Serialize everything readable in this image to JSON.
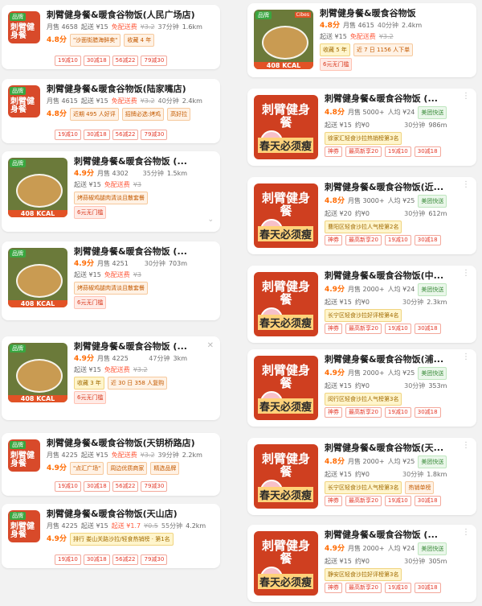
{
  "shop_name": "刺臂健身餐&暖食谷物饭",
  "left": [
    {
      "name": "刺臂健身餐&暖食谷物饭(人民广场店)",
      "sales": "月售 4658",
      "start": "起送 ¥15",
      "free": "免配送费",
      "orig": "¥3.2",
      "eta": "37分钟",
      "dist": "1.6km",
      "score": "4.8分",
      "badges": [
        "\"沙面街腊海鲜卖\"",
        "收藏 4 年"
      ],
      "coupons": [
        "19减10",
        "30减18",
        "56减22",
        "79减30"
      ]
    },
    {
      "name": "刺臂健身餐&暖食谷物饭(陆家嘴店)",
      "sales": "月售 4615",
      "start": "起送 ¥15",
      "free": "免配送费",
      "orig": "¥3.2",
      "eta": "40分钟",
      "dist": "2.4km",
      "score": "4.8分",
      "badges": [
        "近期 495 人好评",
        "招牌必选:烤鸡",
        "高好拉"
      ],
      "coupons": [
        "19减10",
        "30减18",
        "56减22",
        "79减30"
      ]
    },
    {
      "name": "刺臂健身餐&暖食谷物饭 (...",
      "score": "4.9分",
      "sales": "月售 4302",
      "eta": "35分钟",
      "dist": "1.5km",
      "start": "起送 ¥15",
      "free": "免配送费",
      "orig": "¥3",
      "badges": [
        "烤蒜椒鸡腿肉清淡且散套餐",
        "6元无门槛"
      ],
      "coupons": [
        "19减10",
        "30减18",
        "56减22",
        "79减30"
      ],
      "kcal": "408 KCAL",
      "tag": "品牌"
    },
    {
      "name": "刺臂健身餐&暖食谷物饭 (...",
      "score": "4.9分",
      "sales": "月售 4251",
      "eta": "30分钟",
      "dist": "703m",
      "start": "起送 ¥15",
      "free": "免配送费",
      "orig": "¥3",
      "badges": [
        "烤蒜椒鸡腿肉清淡且散套餐",
        "6元无门槛"
      ],
      "coupons": [],
      "kcal": "408 KCAL",
      "tag": "品牌"
    },
    {
      "name": "刺臂健身餐&暖食谷物饭 (...",
      "score": "4.9分",
      "sales": "月售 4225",
      "eta": "47分钟",
      "dist": "3km",
      "start": "起送 ¥15",
      "free": "免配送费",
      "orig": "¥3.2",
      "badges": [
        "收藏 3 年",
        "近 30 日 358 人复购",
        "6元无门槛"
      ],
      "coupons": [],
      "kcal": "408 KCAL",
      "tag": "品牌"
    },
    {
      "name": "刺臂健身餐&暖食谷物饭(天钥桥路店)",
      "sales": "月售 4225",
      "start": "起送 ¥15",
      "free": "免配送费",
      "orig": "¥3.2",
      "eta": "39分钟",
      "dist": "2.2km",
      "score": "4.9分",
      "badges": [
        "\"点汇广场\"",
        "周边优质商家",
        "精选品牌"
      ],
      "coupons": [
        "19减10",
        "30减18",
        "56减22",
        "79减30"
      ]
    },
    {
      "name": "刺臂健身餐&暖食谷物饭(天山店)",
      "sales": "月售 4225",
      "start": "起送 ¥15",
      "free": "起送 ¥1.7",
      "orig": "¥0.5",
      "eta": "55分钟",
      "dist": "4.2km",
      "score": "4.9分",
      "badges": [
        "排行 娄山关路沙拉/轻食热销榜 · 第1名"
      ],
      "coupons": [
        "19减10",
        "30减18",
        "56减22",
        "79减30"
      ]
    }
  ],
  "right": [
    {
      "name": "刺臂健身餐&暖食谷物饭",
      "score": "4.8分",
      "sales": "月售 4615",
      "eta": "40分钟",
      "dist": "2.4km",
      "start": "起送 ¥15",
      "free": "免配送费",
      "orig": "¥3.2",
      "badges": [
        "收藏 5 年",
        "近 7 日 1156 人下单",
        "6元无门槛"
      ],
      "coupons": [],
      "kcal": "408 KCAL",
      "tag": "品牌",
      "logo": "Cibes"
    },
    {
      "name": "刺臂健身餐&暖食谷物饭 (...",
      "score": "4.8分",
      "sales": "月售 5000+",
      "avg": "人均 ¥24",
      "start": "起送 ¥15",
      "free": "约¥0",
      "eta": "30分钟",
      "dist": "986m",
      "badges": [
        "徐家汇轻食沙拉热销榜第3名"
      ],
      "coupons": [
        "最高新享20",
        "19减10",
        "30减18"
      ],
      "delivery": "美团快送",
      "hot": "神券"
    },
    {
      "name": "刺臂健身餐&暖食谷物饭(近...",
      "score": "4.8分",
      "sales": "月售 3000+",
      "avg": "人均 ¥25",
      "start": "起送 ¥20",
      "free": "约¥0",
      "eta": "30分钟",
      "dist": "612m",
      "badges": [
        "曹阳区轻食沙拉人气榜第2名"
      ],
      "coupons": [
        "最高新享20",
        "19减10",
        "30减18"
      ],
      "delivery": "美团快送",
      "hot": "神券"
    },
    {
      "name": "刺臂健身餐&暖食谷物饭(中...",
      "score": "4.9分",
      "sales": "月售 2000+",
      "avg": "人均 ¥24",
      "start": "起送 ¥15",
      "free": "约¥0",
      "eta": "30分钟",
      "dist": "2.3km",
      "badges": [
        "长宁区轻食沙拉好评榜第4名"
      ],
      "coupons": [
        "最高新享20",
        "19减10",
        "30减18"
      ],
      "delivery": "美团快送",
      "hot": "神券"
    },
    {
      "name": "刺臂健身餐&暖食谷物饭(浦...",
      "score": "4.9分",
      "sales": "月售 2000+",
      "avg": "人均 ¥25",
      "start": "起送 ¥15",
      "free": "约¥0",
      "eta": "30分钟",
      "dist": "353m",
      "badges": [
        "闵行区轻食沙拉人气榜第3名"
      ],
      "coupons": [
        "最高新享20",
        "19减10",
        "30减18"
      ],
      "delivery": "美团快送",
      "hot": "神券"
    },
    {
      "name": "刺臂健身餐&暖食谷物饭(天...",
      "score": "4.8分",
      "sales": "月售 2000+",
      "avg": "人均 ¥25",
      "start": "起送 ¥15",
      "free": "约¥0",
      "eta": "30分钟",
      "dist": "1.8km",
      "badges": [
        "长宁区轻食沙拉人气榜第3名",
        "热销单榜"
      ],
      "coupons": [
        "最高新享20",
        "19减10",
        "30减18"
      ],
      "delivery": "美团快送",
      "hot": "神券"
    },
    {
      "name": "刺臂健身餐&暖食谷物饭 (...",
      "score": "4.9分",
      "sales": "月售 2000+",
      "avg": "人均 ¥24",
      "start": "起送 ¥15",
      "free": "约¥0",
      "eta": "30分钟",
      "dist": "305m",
      "badges": [
        "静安区轻食沙拉好评榜第3名"
      ],
      "coupons": [
        "最高新享20",
        "19减10",
        "30减18"
      ],
      "delivery": "美团快送",
      "hot": "神券"
    }
  ],
  "big_thumb": {
    "logo": "刺臂健身餐",
    "sub": "暖食谷物饭",
    "slogan": "春天必须瘦",
    "brand": "Cibes"
  },
  "small_thumb": {
    "logo": "刺臂健身餐",
    "sub": "品牌"
  }
}
